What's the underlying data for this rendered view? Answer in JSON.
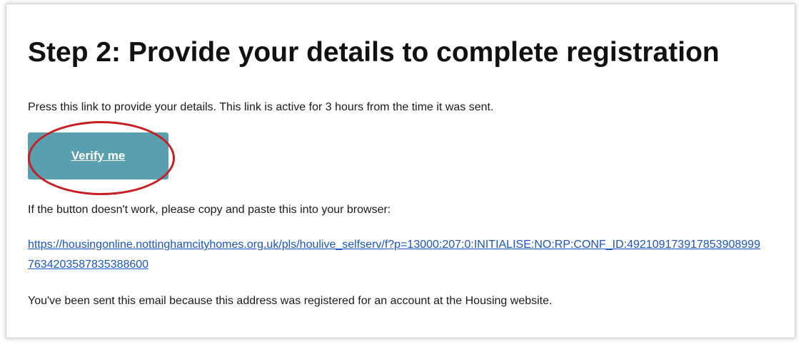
{
  "email": {
    "heading": "Step 2: Provide your details to complete registration",
    "intro": "Press this link to provide your details. This link is active for 3 hours from the time it was sent.",
    "verify_button_label": "Verify me",
    "fallback_text": "If the button doesn't work, please copy and paste this into your browser:",
    "link_text": "https://housingonline.nottinghamcityhomes.org.uk/pls/houlive_selfserv/f?p=13000:207:0:INITIALISE:NO:RP:CONF_ID:4921091739178539089997634203587835388600",
    "footer_text": "You've been sent this email because this address was registered for an account at the Housing website."
  },
  "colors": {
    "button": "#5a9fb0",
    "link": "#1a55c4",
    "annotation_ring": "#c81d22"
  }
}
